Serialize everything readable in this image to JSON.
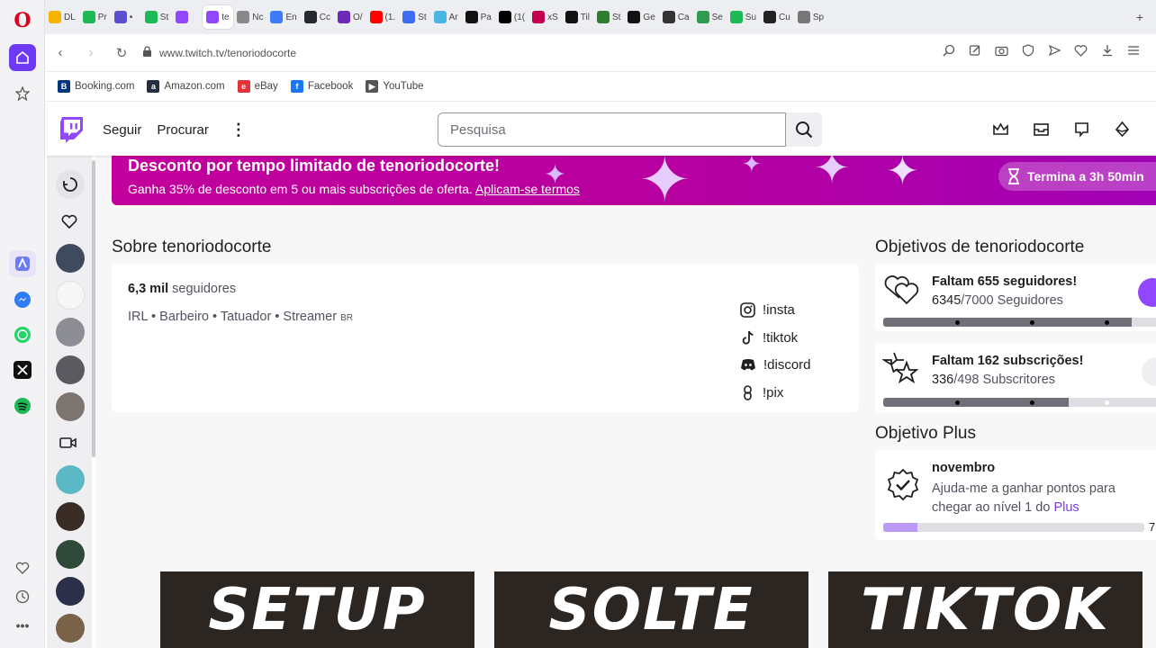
{
  "browser": {
    "tabs": [
      {
        "label": "DL",
        "color": "#f5b400",
        "active": false
      },
      {
        "label": "Pr",
        "color": "#1db954",
        "active": false
      },
      {
        "label": "•",
        "color": "#5a4fcf",
        "active": false
      },
      {
        "label": "St",
        "color": "#1db954",
        "active": false
      },
      {
        "label": "",
        "color": "#9146ff",
        "active": false
      },
      {
        "label": "te",
        "color": "#9146ff",
        "active": true
      },
      {
        "label": "Nc",
        "color": "#888888",
        "active": false
      },
      {
        "label": "En",
        "color": "#3d7bfd",
        "active": false
      },
      {
        "label": "Cc",
        "color": "#24292f",
        "active": false
      },
      {
        "label": "O/",
        "color": "#6b2bb8",
        "active": false
      },
      {
        "label": "(1.",
        "color": "#ff0000",
        "active": false
      },
      {
        "label": "St",
        "color": "#3d6df2",
        "active": false
      },
      {
        "label": "Ar",
        "color": "#4bb6e6",
        "active": false
      },
      {
        "label": "Pa",
        "color": "#111111",
        "active": false
      },
      {
        "label": "(1(",
        "color": "#000000",
        "active": false
      },
      {
        "label": "xS",
        "color": "#c2004f",
        "active": false
      },
      {
        "label": "Til",
        "color": "#111111",
        "active": false
      },
      {
        "label": "St",
        "color": "#2e7d32",
        "active": false
      },
      {
        "label": "Ge",
        "color": "#111111",
        "active": false
      },
      {
        "label": "Ca",
        "color": "#333333",
        "active": false
      },
      {
        "label": "Se",
        "color": "#2e9b4f",
        "active": false
      },
      {
        "label": "Su",
        "color": "#1db954",
        "active": false
      },
      {
        "label": "Cu",
        "color": "#222222",
        "active": false
      },
      {
        "label": "Sp",
        "color": "#777777",
        "active": false
      }
    ],
    "url": "www.twitch.tv/tenoriodocorte",
    "bookmarks": [
      {
        "label": "Booking.com",
        "badge": "B",
        "color": "#003580"
      },
      {
        "label": "Amazon.com",
        "badge": "a",
        "color": "#232f3e"
      },
      {
        "label": "eBay",
        "badge": "e",
        "color": "#e53238"
      },
      {
        "label": "Facebook",
        "badge": "f",
        "color": "#1877f2"
      },
      {
        "label": "YouTube",
        "badge": "▶",
        "color": "#555555"
      }
    ]
  },
  "twitch": {
    "nav": {
      "follow": "Seguir",
      "browse": "Procurar",
      "more": "⋮"
    },
    "search_placeholder": "Pesquisa",
    "banner": {
      "title": "Desconto por tempo limitado de tenoriodocorte!",
      "text": "Ganha 35% de desconto em 5 ou mais subscrições de oferta. ",
      "link": "Aplicam-se termos",
      "timer": "Termina a 3h 50min"
    },
    "about": {
      "title": "Sobre tenoriodocorte",
      "followers_count": "6,3 mil",
      "followers_label": "seguidores",
      "description": "IRL • Barbeiro • Tatuador • Streamer",
      "description_tag": "BR",
      "links": [
        "!insta",
        "!tiktok",
        "!discord",
        "!pix"
      ]
    },
    "goals": {
      "title": "Objetivos de tenoriodocorte",
      "items": [
        {
          "headline": "Faltam 655 seguidores!",
          "current": "6345",
          "target": "/7000 Seguidores",
          "progress": 0.906
        },
        {
          "headline": "Faltam 162 subscrições!",
          "current": "336",
          "target": "/498 Subscritores",
          "progress": 0.675
        }
      ]
    },
    "plus": {
      "title": "Objetivo Plus",
      "month": "novembro",
      "text": "Ajuda-me a ganhar pontos para chegar ao nível 1 do ",
      "keyword": "Plus",
      "progress": 0.13,
      "number": "7"
    },
    "panels": [
      "SETUP",
      "SOLTE",
      "TIKTOK"
    ]
  },
  "colors": {
    "twitch_purple": "#9146ff",
    "banner": "#b6009f"
  }
}
